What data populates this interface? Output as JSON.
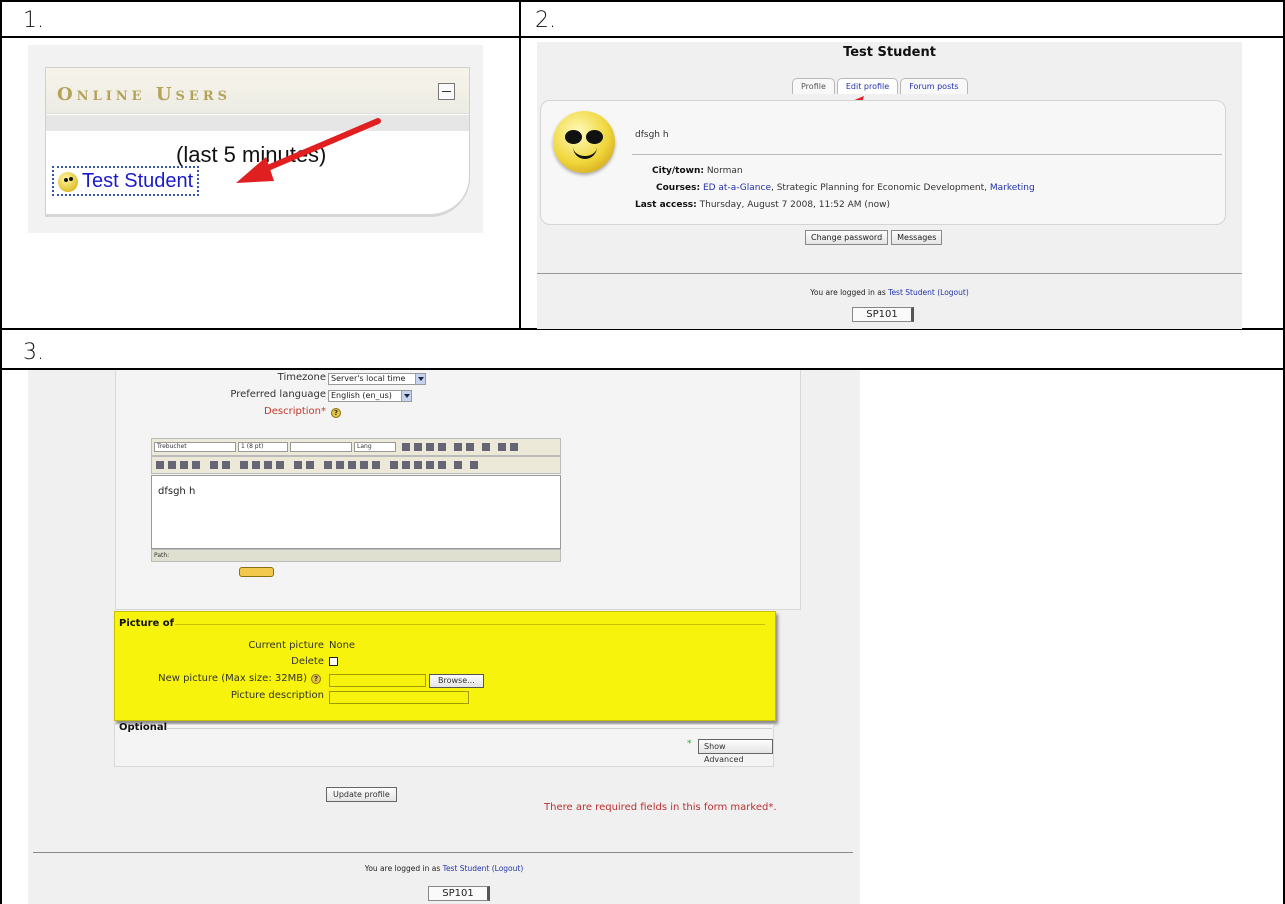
{
  "steps": [
    "1.",
    "2.",
    "3."
  ],
  "panel1": {
    "block_title": "Online Users",
    "range_text": "(last 5 minutes)",
    "user_name": "Test Student"
  },
  "panel2": {
    "title": "Test Student",
    "tabs": [
      "Profile",
      "Edit profile",
      "Forum posts"
    ],
    "description": "dfsgh h",
    "city_label": "City/town:",
    "city_value": "Norman",
    "courses_label": "Courses:",
    "courses": [
      "ED at-a-Glance",
      ", Strategic Planning for Economic Development, ",
      "Marketing"
    ],
    "last_access_label": "Last access:",
    "last_access_value": "Thursday, August 7 2008, 11:52 AM  (now)",
    "buttons": [
      "Change password",
      "Messages"
    ],
    "logged_prefix": "You are logged in as ",
    "logged_user": "Test Student",
    "logout": "(Logout)",
    "course_button": "SP101"
  },
  "panel3": {
    "timezone_label": "Timezone",
    "timezone_value": "Server's local time",
    "language_label": "Preferred language",
    "language_value": "English (en_us)",
    "description_label": "Description*",
    "editor": {
      "font": "Trebuchet",
      "size": "1 (8 pt)",
      "lang": "Lang",
      "content": "dfsgh h",
      "path_label": "Path:"
    },
    "picture_legend": "Picture of",
    "current_picture_label": "Current picture",
    "current_picture_value": "None",
    "delete_label": "Delete",
    "new_picture_label": "New picture (Max size: 32MB)",
    "browse_button": "Browse...",
    "picture_description_label": "Picture description",
    "optional_legend": "Optional",
    "show_advanced_button": "Show Advanced",
    "update_button": "Update profile",
    "required_note": "There are required fields in this form marked*.",
    "logged_prefix": "You are logged in as ",
    "logged_user": "Test Student",
    "logout": "(Logout)",
    "course_button": "SP101"
  },
  "colors": {
    "link": "#2233aa",
    "highlight_yellow": "#f7f30c",
    "arrow_red": "#e02020",
    "required_red": "#b83030"
  }
}
